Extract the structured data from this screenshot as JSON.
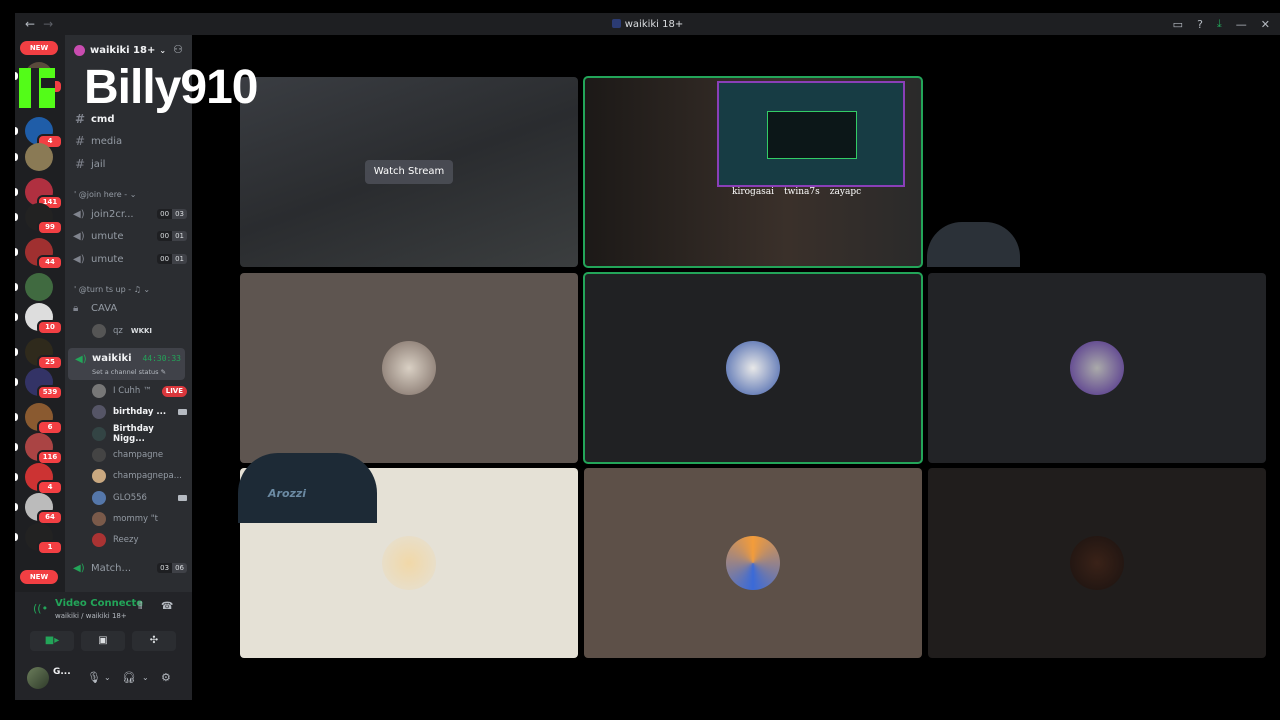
{
  "window": {
    "title": "waikiki 18+",
    "nav_back": "←",
    "nav_forward": "→",
    "inbox_icon": "inbox-icon",
    "help_icon": "help-icon",
    "download_icon": "download-icon",
    "minimize": "—",
    "close": "✕"
  },
  "overlay": {
    "watermark": "Billy910"
  },
  "rail": {
    "new_top": "NEW",
    "new_bottom": "NEW",
    "servers": [
      {
        "badge": "2",
        "color": "#5a4b3c"
      },
      {
        "badge": "4",
        "color": "#1f5da8"
      },
      {
        "badge": "",
        "color": "#8a7a55"
      },
      {
        "badge": "141",
        "color": "#b03040"
      },
      {
        "badge": "99",
        "color": "#222"
      },
      {
        "badge": "44",
        "color": "#a03030"
      },
      {
        "badge": "",
        "color": "#406a40"
      },
      {
        "badge": "10",
        "color": "#dddddd"
      },
      {
        "badge": "25",
        "color": "#2f2a1c"
      },
      {
        "badge": "539",
        "color": "#333366"
      },
      {
        "badge": "6",
        "color": "#8a5a30"
      },
      {
        "badge": "116",
        "color": "#aa4444"
      },
      {
        "badge": "4",
        "color": "#cc3333"
      },
      {
        "badge": "64",
        "color": "#bbbbbb"
      },
      {
        "badge": "1",
        "color": "#222"
      }
    ]
  },
  "sidebar": {
    "guild_name": "waikiki 18+",
    "channels_top": [
      {
        "name": "cmd",
        "bright": true
      },
      {
        "name": "media",
        "bright": false
      },
      {
        "name": "jail",
        "bright": false
      }
    ],
    "cat_join": "' @join here -",
    "voice_join": [
      {
        "name": "join2cr...",
        "a": "00",
        "b": "03"
      },
      {
        "name": "umute",
        "a": "00",
        "b": "01"
      },
      {
        "name": "umute",
        "a": "00",
        "b": "01"
      }
    ],
    "cat_turn": "' @turn ts up -",
    "locked_channel": "CAVA",
    "cava_user": "qz",
    "cava_user_tag": "WKKI",
    "active_channel": {
      "name": "waikiki",
      "timer": "44:30:33",
      "status": "Set a channel status"
    },
    "members": [
      {
        "name": "I Cuhh ™",
        "tag": "LIVE",
        "bright": false,
        "color": "#777"
      },
      {
        "name": "birthday ...",
        "tag": "cam",
        "bright": true,
        "color": "#556"
      },
      {
        "name": "Birthday Nigg...",
        "tag": "",
        "bright": true,
        "color": "#344"
      },
      {
        "name": "champagne",
        "tag": "",
        "bright": false,
        "color": "#444"
      },
      {
        "name": "champagnepa...",
        "tag": "",
        "bright": false,
        "color": "#c9a880"
      },
      {
        "name": "GLO556",
        "tag": "cam",
        "bright": false,
        "color": "#5577aa"
      },
      {
        "name": "mommy \"t",
        "tag": "",
        "bright": false,
        "color": "#7a5a4a"
      },
      {
        "name": "Reezy",
        "tag": "",
        "bright": false,
        "color": "#aa3333"
      }
    ],
    "match_channel": {
      "name": "Match...",
      "a": "03",
      "b": "06"
    }
  },
  "voice": {
    "status": "Video Connecte",
    "location": "waikiki / waikiki 18+",
    "user_short": "G..."
  },
  "stream": {
    "watch_label": "Watch Stream",
    "socials": [
      "kirogasai",
      "twina7s",
      "zayapc"
    ]
  },
  "decor": {
    "chair_brand": "Arozzi"
  }
}
